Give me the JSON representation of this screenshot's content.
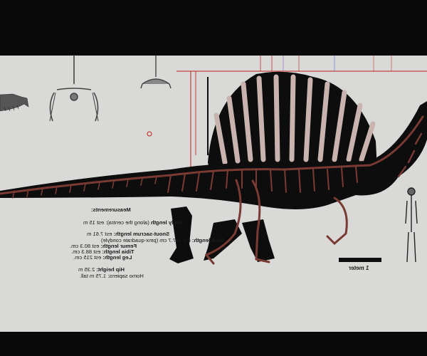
{
  "plate": {
    "measurements_heading": "Measurements:",
    "body_length_label": "Body length",
    "body_length_value": "(along the centra): est 15 m",
    "snout_sacrum_label": "Snout-sacrum length:",
    "snout_sacrum_value": "est 7.61 m",
    "skull_label": "Skull length:",
    "skull_value": "est 147.7 cm (pmx-quadrate condyle)",
    "femur_label": "Femur length:",
    "femur_value": "est 80.3 cm.",
    "tibia_label": "Tibia length:",
    "tibia_value": "est 88.3 cm.",
    "leg_label": "Leg length:",
    "leg_value": "est 215 cm.",
    "hip_label": "Hip height:",
    "hip_value": "2.35 m",
    "human_line": "Homo sapiens: 1.75 m tall.",
    "scale_bar_label": "1 meter"
  },
  "colors": {
    "frame": "#0a0a0a",
    "plate": "#d9d9d7",
    "silhouette": "#0d0d0d",
    "bone": "#7a3a34",
    "guide_red": "#c0201c",
    "guide_green": "#1f9a3a"
  }
}
